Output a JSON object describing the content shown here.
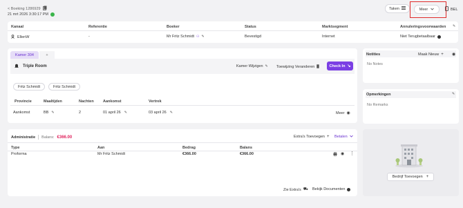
{
  "header": {
    "back_label": "< Boeking 1286929",
    "created": "21 mrt 2026 3:30:17 PM",
    "taken_label": "Taken",
    "meer_label": "Meer",
    "bel_label": "BEL"
  },
  "booking_table": {
    "columns": [
      "Kanaal",
      "Referentie",
      "Boeker",
      "Status",
      "Marktsegment",
      "Annuleringsvoorwaarden"
    ],
    "row": {
      "kanaal": "EllenW",
      "referentie": "-",
      "boeker": "Mr Fritz Schmidt",
      "status": "Bevestigd",
      "marktsegment": "Internet",
      "annulering": "Niet Terugbetaalbaar"
    }
  },
  "room": {
    "tab_label": "Kamer 304",
    "add_tab": "+",
    "room_type": "Triple Room",
    "kamer_wijzigen": "Kamer Wijzigen",
    "toewijzing": "Toewijzing Veranderen",
    "check_in": "Check In",
    "guests": [
      "Fritz Schmidt",
      "Fritz Schmidt"
    ],
    "columns": [
      "Provincie",
      "Maaltijden",
      "Nachten",
      "Aankomst",
      "Vertrek"
    ],
    "row": {
      "provincie": "Aankomst",
      "maaltijden": "BB",
      "nachten": "2",
      "aankomst": "01 april 26",
      "vertrek": "03 april 26"
    },
    "meer_label": "Meer"
  },
  "admin": {
    "title": "Administratie",
    "balans_label": "Balans:",
    "balans_value": "€366.00",
    "extras_toevoegen": "Extra's Toevoegen",
    "betalen": "Betalen",
    "columns": [
      "Type",
      "Aan",
      "Bedrag",
      "Balans"
    ],
    "row": {
      "type": "Proforma",
      "aan": "Mr Fritz Schmidt",
      "bedrag": "€366.00",
      "balans": "€366.00"
    },
    "zie_extras": "Zie Extra's",
    "bekijk_documenten": "Bekijk Documenten"
  },
  "notities": {
    "title": "Notities",
    "maak_nieuw": "Maak Nieuw",
    "empty": "No Notes"
  },
  "opmerkingen": {
    "title": "Opmerkingen",
    "empty": "No Remarks"
  },
  "company": {
    "button_label": "Bedrijf Toevoegen"
  },
  "colors": {
    "accent": "#7b3fe4",
    "balance": "#e0245e",
    "status_green": "#3bb54a",
    "highlight_box": "#e02b2b"
  }
}
